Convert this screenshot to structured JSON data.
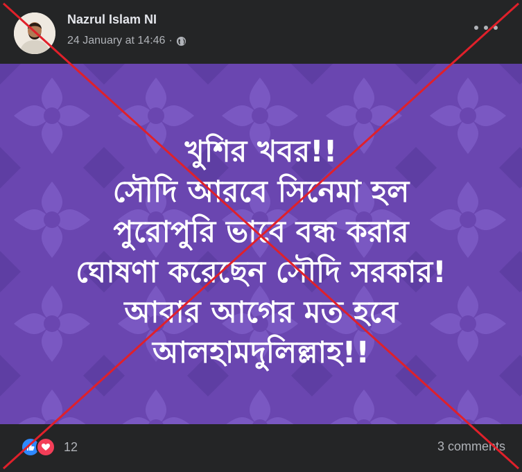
{
  "post": {
    "author": "Nazrul Islam NI",
    "timestamp": "24 January at 14:46",
    "privacy_icon": "globe-icon",
    "more_icon": "more-options-icon"
  },
  "image": {
    "background_color": "#6a46b0",
    "text_lines": [
      "খুশির খবর!!",
      "সৌদি আরবে সিনেমা হল",
      "পুরোপুরি ভাবে বন্ধ করার",
      "ঘোষণা করেছেন সৌদি সরকার!",
      "আবার আগের মত হবে",
      "আলহামদুলিল্লাহ!!"
    ]
  },
  "footer": {
    "reaction_icons": [
      "like-icon",
      "love-icon"
    ],
    "reaction_count": "12",
    "comments_label": "3 comments"
  },
  "overlay": {
    "cross_color": "#e0202a"
  }
}
